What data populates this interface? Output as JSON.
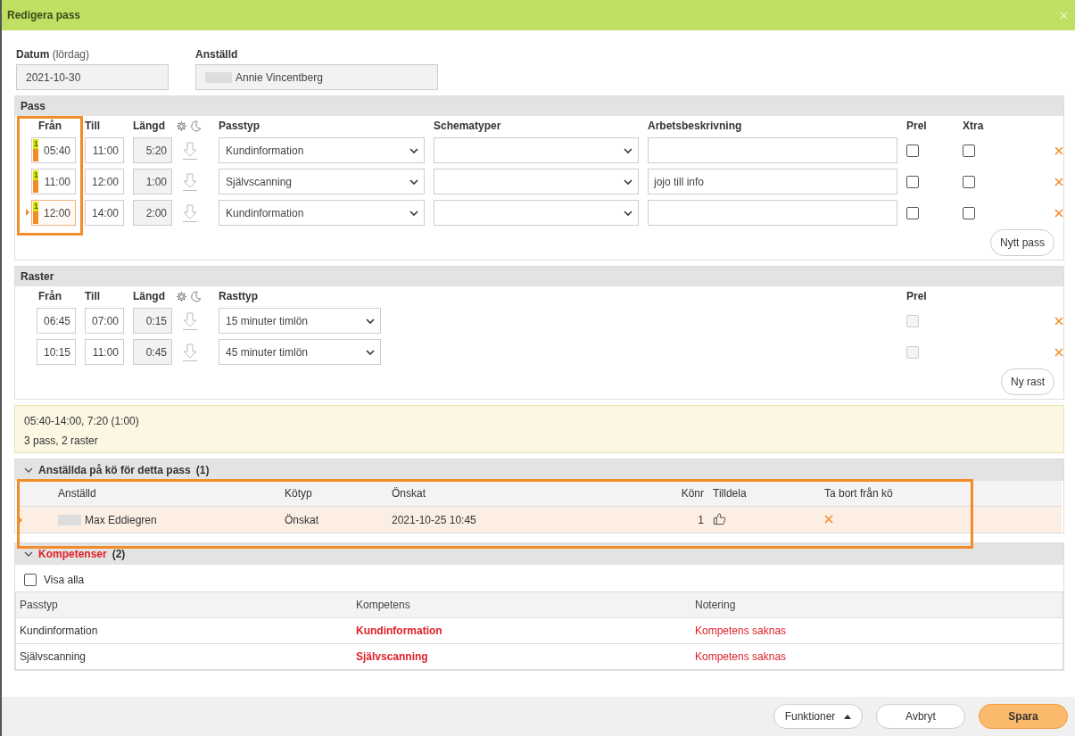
{
  "window": {
    "title": "Redigera pass"
  },
  "date": {
    "label": "Datum",
    "hint": "(lördag)",
    "value": "2021-10-30"
  },
  "employee": {
    "label": "Anställd",
    "value": "Annie Vincentberg"
  },
  "shifts": {
    "title": "Pass",
    "highlighted": true,
    "columns": [
      "Från",
      "Till",
      "Längd",
      "Passtyp",
      "Schematyper",
      "Arbetsbeskrivning",
      "Prel",
      "Xtra"
    ],
    "rows": [
      {
        "badge": "1",
        "from": "05:40",
        "to": "11:00",
        "length": "5:20",
        "type": "Kundinformation",
        "prel": false,
        "xtra": false,
        "current": false
      },
      {
        "badge": "1",
        "from": "11:00",
        "to": "12:00",
        "length": "1:00",
        "type": "Självscanning",
        "description": "jojo till info",
        "prel": false,
        "xtra": false,
        "current": false
      },
      {
        "badge": "1",
        "from": "12:00",
        "to": "14:00",
        "length": "2:00",
        "type": "Kundinformation",
        "prel": false,
        "xtra": false,
        "current": true
      }
    ],
    "add_button": "Nytt pass"
  },
  "breaks": {
    "title": "Raster",
    "columns": [
      "Från",
      "Till",
      "Längd",
      "Rasttyp",
      "Prel"
    ],
    "rows": [
      {
        "from": "06:45",
        "to": "07:00",
        "length": "0:15",
        "type": "15 minuter timlön",
        "prel": false,
        "disabled": true
      },
      {
        "from": "10:15",
        "to": "11:00",
        "length": "0:45",
        "type": "45 minuter timlön",
        "prel": false,
        "disabled": true
      }
    ],
    "add_button": "Ny rast"
  },
  "summary": [
    "05:40-14:00, 7:20 (1:00)",
    "3 pass, 2 raster"
  ],
  "queue": {
    "title": "Anställda på kö för detta pass",
    "count": "(1)",
    "expanded": true,
    "highlighted": true,
    "columns": [
      "Anställd",
      "Kötyp",
      "Önskat",
      "Könr",
      "Tilldela",
      "Ta bort från kö"
    ],
    "rows": [
      {
        "name": "Max Eddiegren",
        "type": "Önskat",
        "wish": "2021-10-25 10:45",
        "number": "1",
        "selected": true
      }
    ]
  },
  "competences": {
    "title": "Kompetenser",
    "count": "(2)",
    "expanded": true,
    "show_all": {
      "label": "Visa alla",
      "checked": false
    },
    "columns": [
      "Passtyp",
      "Kompetens",
      "Notering"
    ],
    "rows": [
      {
        "shift_type": "Kundinformation",
        "competence": "Kundinformation",
        "note": "Kompetens saknas"
      },
      {
        "shift_type": "Självscanning",
        "competence": "Självscanning",
        "note": "Kompetens saknas"
      }
    ]
  },
  "buttons": [
    {
      "label": "Funktioner",
      "kind": "menu"
    },
    {
      "label": "Avbryt",
      "kind": "secondary"
    },
    {
      "label": "Spara",
      "kind": "primary"
    }
  ]
}
